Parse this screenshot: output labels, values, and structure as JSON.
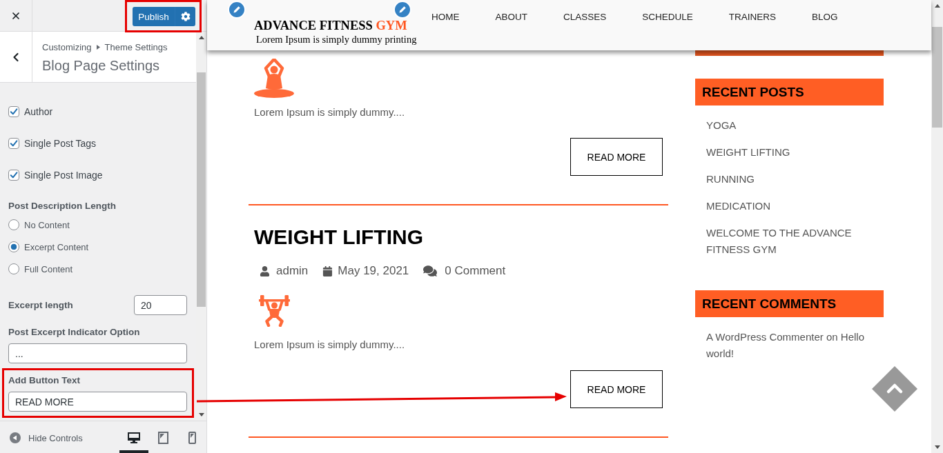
{
  "customizer": {
    "publish": {
      "label": "Publish",
      "highlighted": true
    },
    "breadcrumb": [
      "Customizing",
      "Theme Settings"
    ],
    "title": "Blog Page Settings",
    "checkboxes": [
      {
        "label": "Author",
        "checked": true
      },
      {
        "label": "Single Post Tags",
        "checked": true
      },
      {
        "label": "Single Post Image",
        "checked": true
      }
    ],
    "post_description_length": {
      "label": "Post Description Length",
      "options": [
        {
          "label": "No Content",
          "selected": false
        },
        {
          "label": "Excerpt Content",
          "selected": true
        },
        {
          "label": "Full Content",
          "selected": false
        }
      ]
    },
    "excerpt_length": {
      "label": "Excerpt length",
      "value": "20"
    },
    "excerpt_indicator": {
      "label": "Post Excerpt Indicator Option",
      "value": "..."
    },
    "button_text": {
      "label": "Add Button Text",
      "value": "READ MORE",
      "highlighted": true
    },
    "footer": {
      "hide_controls": "Hide Controls",
      "devices": [
        {
          "kind": "desktop",
          "selected": true
        },
        {
          "kind": "tablet",
          "selected": false
        },
        {
          "kind": "mobile",
          "selected": false
        }
      ]
    }
  },
  "site": {
    "logo": {
      "title": "ADVANCE FITNESS",
      "accent": "GYM",
      "tagline": "Lorem Ipsum is simply dummy printing"
    },
    "nav": [
      "HOME",
      "ABOUT",
      "CLASSES",
      "SCHEDULE",
      "TRAINERS",
      "BLOG"
    ],
    "posts": [
      {
        "excerpt": "Lorem Ipsum is simply dummy....",
        "button": "READ MORE"
      },
      {
        "title": "WEIGHT LIFTING",
        "meta": {
          "author": "admin",
          "date": "May 19, 2021",
          "comments": "0 Comment"
        },
        "excerpt": "Lorem Ipsum is simply dummy....",
        "button": "READ MORE"
      }
    ],
    "widgets": [
      {
        "title": "RECENT POSTS",
        "items": [
          "YOGA",
          "WEIGHT LIFTING",
          "RUNNING",
          "MEDICATION",
          "WELCOME TO THE ADVANCE FITNESS GYM"
        ]
      },
      {
        "title": "RECENT COMMENTS",
        "items": [
          "A WordPress Commenter on Hello world!"
        ]
      }
    ]
  }
}
